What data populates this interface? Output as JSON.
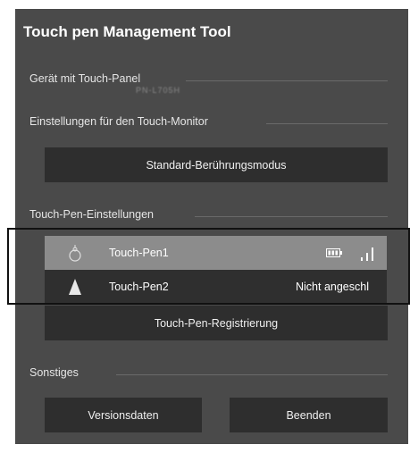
{
  "app": {
    "title": "Touch pen Management Tool"
  },
  "sections": {
    "device_panel_label": "Gerät mit Touch-Panel",
    "device_name": "PN-L705H",
    "monitor_settings_label": "Einstellungen für den Touch-Monitor",
    "pen_settings_label": "Touch-Pen-Einstellungen",
    "misc_label": "Sonstiges"
  },
  "buttons": {
    "standard_mode": "Standard-Berührungsmodus",
    "pen_registration": "Touch-Pen-Registrierung",
    "version_info": "Versionsdaten",
    "quit": "Beenden"
  },
  "pens": [
    {
      "name": "Touch-Pen1",
      "status": "",
      "selected": true,
      "icon": "pen-round-icon",
      "battery_icon": "battery-icon",
      "signal_icon": "signal-strength-icon"
    },
    {
      "name": "Touch-Pen2",
      "status": "Nicht angeschl",
      "selected": false,
      "icon": "pen-triangle-icon"
    }
  ],
  "colors": {
    "panel_bg": "#4a4a4a",
    "button_bg": "#2e2e2e",
    "selected_row_bg": "#8c8c8c"
  }
}
